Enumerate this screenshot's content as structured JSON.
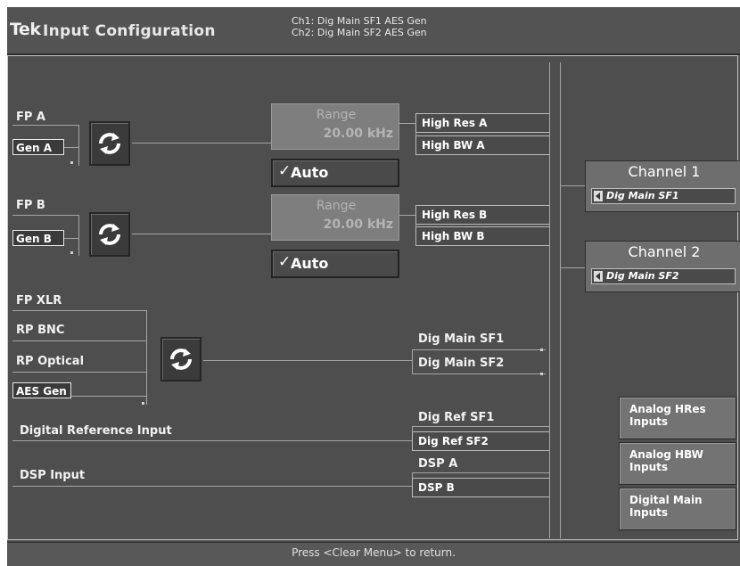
{
  "header": {
    "brand": "Tek",
    "title": "Input Configuration",
    "status_line1": "Ch1: Dig Main SF1 AES Gen",
    "status_line2": "Ch2: Dig Main SF2 AES Gen"
  },
  "inputs": {
    "fp_a": {
      "label": "FP A",
      "selected": "Gen A"
    },
    "fp_b": {
      "label": "FP B",
      "selected": "Gen B"
    },
    "digital_group": {
      "fp_xlr": "FP XLR",
      "rp_bnc": "RP BNC",
      "rp_optical": "RP Optical",
      "selected": "AES Gen"
    },
    "digital_reference": "Digital Reference Input",
    "dsp_input": "DSP Input"
  },
  "range_a": {
    "label": "Range",
    "value": "20.00 kHz",
    "auto_label": "Auto",
    "auto_checked": true
  },
  "range_b": {
    "label": "Range",
    "value": "20.00 kHz",
    "auto_label": "Auto",
    "auto_checked": true
  },
  "outputs": {
    "high_res_a": "High Res A",
    "high_bw_a": "High BW A",
    "high_res_b": "High Res B",
    "high_bw_b": "High BW B",
    "dig_main_sf1": "Dig Main SF1",
    "dig_main_sf2": "Dig Main SF2",
    "dig_ref_sf1": "Dig Ref SF1",
    "dig_ref_sf2": "Dig Ref SF2",
    "dsp_a": "DSP A",
    "dsp_b": "DSP B"
  },
  "channels": [
    {
      "label": "Channel 1",
      "source": "Dig Main SF1"
    },
    {
      "label": "Channel 2",
      "source": "Dig Main SF2"
    }
  ],
  "side_buttons": {
    "analog_hres": {
      "line1": "Analog HRes",
      "line2": "Inputs"
    },
    "analog_hbw": {
      "line1": "Analog HBW",
      "line2": "Inputs"
    },
    "digital_main": {
      "line1": "Digital Main",
      "line2": "Inputs"
    }
  },
  "footer": {
    "hint": "Press <Clear Menu> to return."
  },
  "colors": {
    "background": "#4e4e4e",
    "header": "#535353",
    "line": "#a5a5a5",
    "text": "#f2f2f2"
  },
  "icons": {
    "switch": "circular-arrows-icon",
    "checkmark": "check-icon",
    "left_arrow": "left-arrow-icon"
  }
}
